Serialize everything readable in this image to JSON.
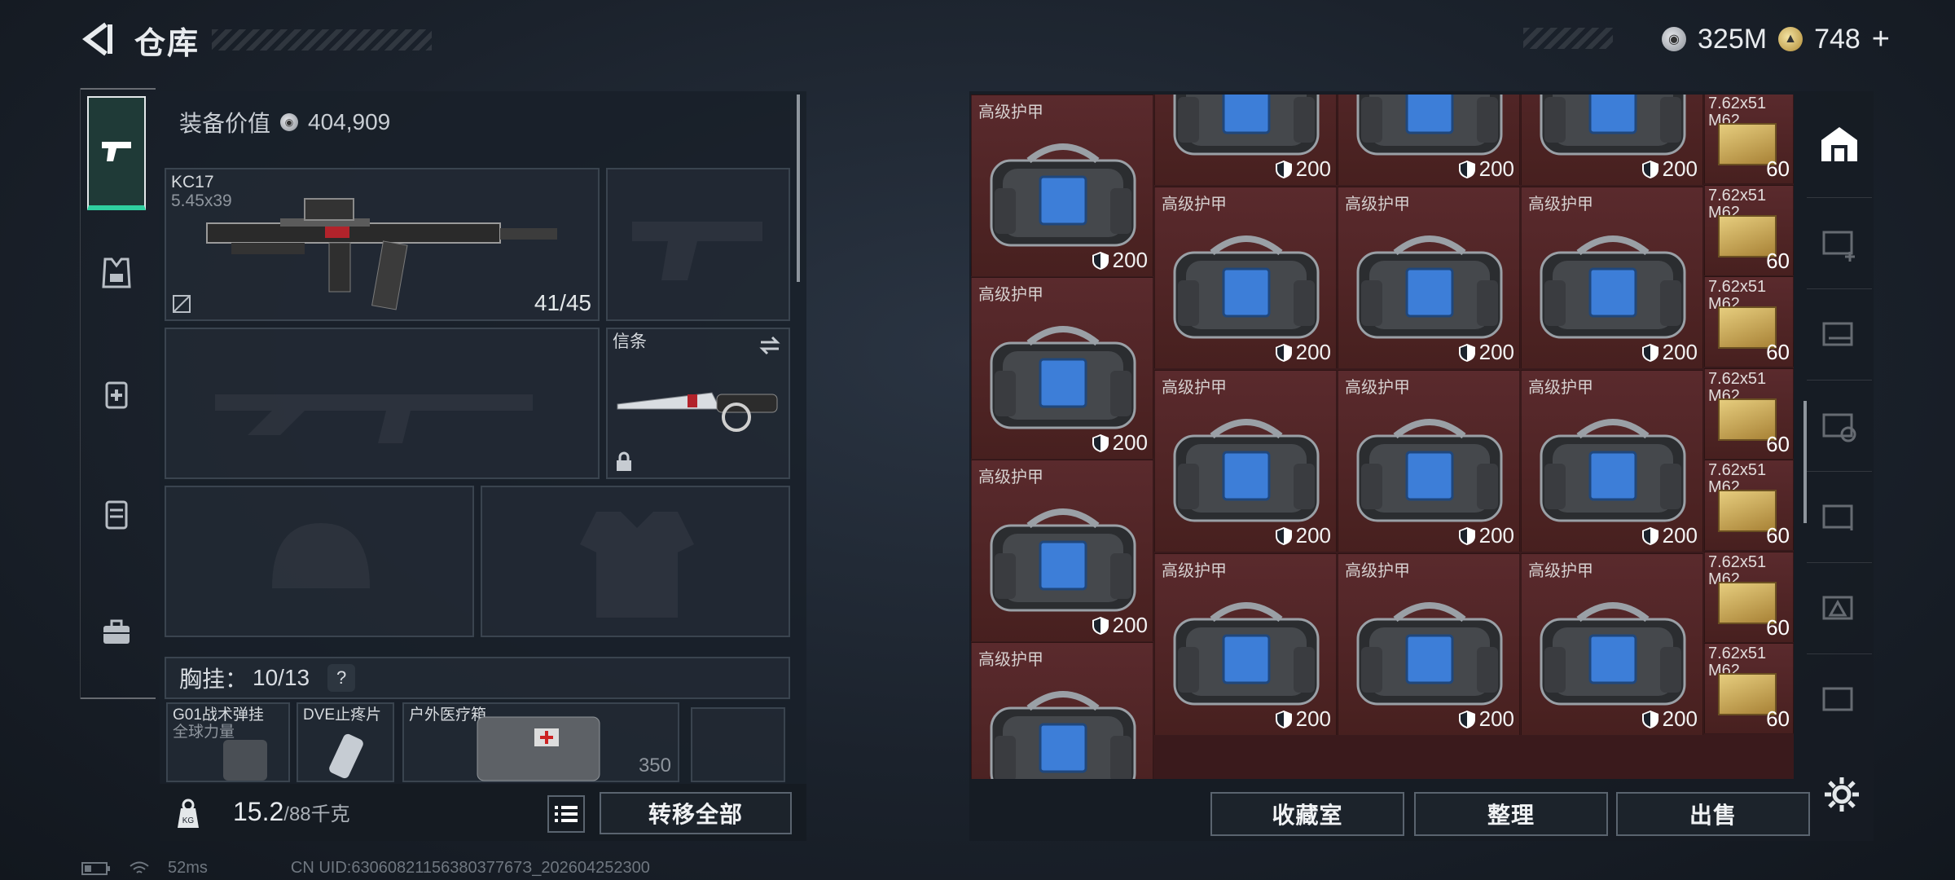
{
  "header": {
    "title": "仓库",
    "currency_silver": "325M",
    "currency_gold": "748",
    "gold_plus": "+"
  },
  "loadout": {
    "value_label": "装备价值",
    "value": "404,909",
    "primary_weapon": {
      "name": "KC17",
      "caliber": "5.45x39",
      "ammo": "41/45"
    },
    "melee_slot_label": "信条",
    "chest_rig_label": "胸挂：",
    "chest_rig_capacity": "10/13",
    "help_label": "?",
    "items": [
      {
        "name": "G01战术弹挂",
        "sub": "全球力量"
      },
      {
        "name": "DVE止疼片",
        "sub": ""
      },
      {
        "name": "户外医疗箱",
        "sub": "",
        "count": "350"
      }
    ],
    "weight_value": "15.2",
    "weight_limit": "/88千克",
    "transfer_all_label": "转移全部"
  },
  "storage": {
    "armor_name": "高级护甲",
    "armor_durability": "200",
    "ammo_name": "7.62x51",
    "ammo_sub": "M62",
    "ammo_count": "60",
    "buttons": {
      "collection": "收藏室",
      "sort": "整理",
      "sell": "出售"
    }
  },
  "status_bar": {
    "ping": "52ms",
    "uid": "CN UID:6306082115638037767З_202604252300"
  },
  "colors": {
    "accent": "#2fd0a0",
    "cell_bg": "#4e2426",
    "panel": "#19202a"
  }
}
